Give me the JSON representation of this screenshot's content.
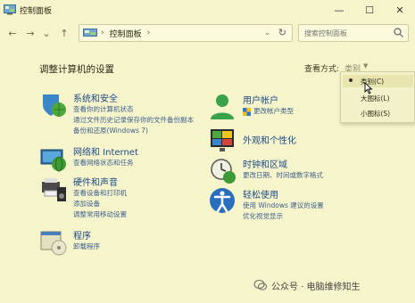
{
  "window": {
    "title": "控制面板",
    "minimize_glyph": "—",
    "maximize_glyph": "☐",
    "close_glyph": "✕"
  },
  "nav": {
    "back_glyph": "←",
    "forward_glyph": "→",
    "recent_glyph": "⌄",
    "up_glyph": "↑",
    "breadcrumb": "控制面板",
    "search_placeholder": "搜索控制面板"
  },
  "main": {
    "heading": "调整计算机的设置",
    "view_by_label": "查看方式:",
    "view_by_value": "类别"
  },
  "view_menu": {
    "items": [
      "类别(C)",
      "大图标(L)",
      "小图标(S)"
    ],
    "selected_index": 0
  },
  "categories": {
    "system_security": {
      "title": "系统和安全",
      "links": [
        "查看你的计算机状态",
        "通过文件历史记录保存你的文件备份副本",
        "备份和还原(Windows 7)"
      ]
    },
    "network": {
      "title": "网络和 Internet",
      "links": [
        "查看网络状态和任务"
      ]
    },
    "hardware": {
      "title": "硬件和声音",
      "links": [
        "查看设备和打印机",
        "添加设备",
        "调整常用移动设置"
      ]
    },
    "programs": {
      "title": "程序",
      "links": [
        "卸载程序"
      ]
    },
    "user_accounts": {
      "title": "用户帐户",
      "links": [
        "更改帐户类型"
      ]
    },
    "appearance": {
      "title": "外观和个性化",
      "links": []
    },
    "clock": {
      "title": "时钟和区域",
      "links": [
        "更改日期、时间或数字格式"
      ]
    },
    "ease": {
      "title": "轻松使用",
      "links": [
        "使用 Windows 建议的设置",
        "优化视觉显示"
      ]
    }
  },
  "watermark": {
    "text": "公众号 · 电脑维修知生"
  },
  "colors": {
    "background": "#f6f4ca",
    "link": "#3c5f8e",
    "title": "#1d4a8a"
  }
}
